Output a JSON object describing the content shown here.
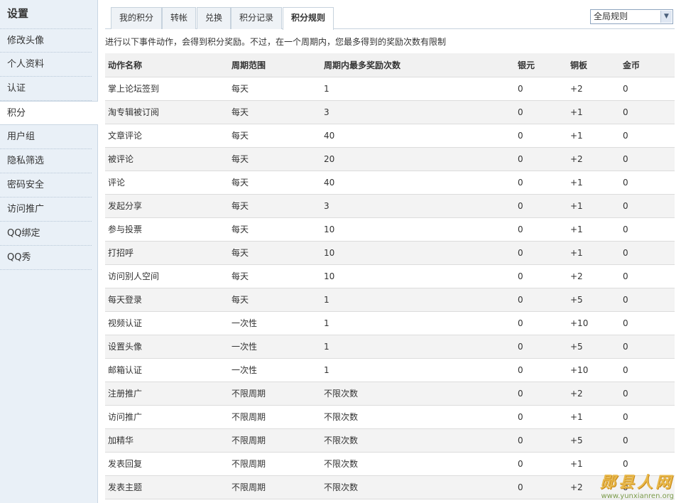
{
  "sidebar": {
    "title": "设置",
    "items": [
      {
        "label": "修改头像"
      },
      {
        "label": "个人资料"
      },
      {
        "label": "认证"
      },
      {
        "label": "积分"
      },
      {
        "label": "用户组"
      },
      {
        "label": "隐私筛选"
      },
      {
        "label": "密码安全"
      },
      {
        "label": "访问推广"
      },
      {
        "label": "QQ绑定"
      },
      {
        "label": "QQ秀"
      }
    ],
    "active_index": 3
  },
  "tabs": [
    {
      "label": "我的积分"
    },
    {
      "label": "转帐"
    },
    {
      "label": "兑换"
    },
    {
      "label": "积分记录"
    },
    {
      "label": "积分规则"
    }
  ],
  "active_tab": 4,
  "scope_select": {
    "value": "全局规则"
  },
  "intro": "进行以下事件动作，会得到积分奖励。不过，在一个周期内，您最多得到的奖励次数有限制",
  "table": {
    "headers": [
      "动作名称",
      "周期范围",
      "周期内最多奖励次数",
      "银元",
      "铜板",
      "金币"
    ],
    "rows": [
      [
        "掌上论坛签到",
        "每天",
        "1",
        "0",
        "+2",
        "0"
      ],
      [
        "淘专辑被订阅",
        "每天",
        "3",
        "0",
        "+1",
        "0"
      ],
      [
        "文章评论",
        "每天",
        "40",
        "0",
        "+1",
        "0"
      ],
      [
        "被评论",
        "每天",
        "20",
        "0",
        "+2",
        "0"
      ],
      [
        "评论",
        "每天",
        "40",
        "0",
        "+1",
        "0"
      ],
      [
        "发起分享",
        "每天",
        "3",
        "0",
        "+1",
        "0"
      ],
      [
        "参与投票",
        "每天",
        "10",
        "0",
        "+1",
        "0"
      ],
      [
        "打招呼",
        "每天",
        "10",
        "0",
        "+1",
        "0"
      ],
      [
        "访问别人空间",
        "每天",
        "10",
        "0",
        "+2",
        "0"
      ],
      [
        "每天登录",
        "每天",
        "1",
        "0",
        "+5",
        "0"
      ],
      [
        "视频认证",
        "一次性",
        "1",
        "0",
        "+10",
        "0"
      ],
      [
        "设置头像",
        "一次性",
        "1",
        "0",
        "+5",
        "0"
      ],
      [
        "邮箱认证",
        "一次性",
        "1",
        "0",
        "+10",
        "0"
      ],
      [
        "注册推广",
        "不限周期",
        "不限次数",
        "0",
        "+2",
        "0"
      ],
      [
        "访问推广",
        "不限周期",
        "不限次数",
        "0",
        "+1",
        "0"
      ],
      [
        "加精华",
        "不限周期",
        "不限次数",
        "0",
        "+5",
        "0"
      ],
      [
        "发表回复",
        "不限周期",
        "不限次数",
        "0",
        "+1",
        "0"
      ],
      [
        "发表主题",
        "不限周期",
        "不限次数",
        "0",
        "+2",
        "0"
      ]
    ]
  },
  "watermark": {
    "text": "郧县人网",
    "url": "www.yunxianren.org"
  }
}
